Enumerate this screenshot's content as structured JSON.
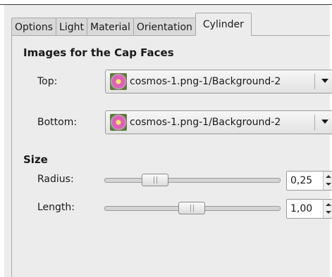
{
  "tabs": [
    {
      "label": "Options",
      "active": false
    },
    {
      "label": "Light",
      "active": false
    },
    {
      "label": "Material",
      "active": false
    },
    {
      "label": "Orientation",
      "active": false
    },
    {
      "label": "Cylinder",
      "active": true
    }
  ],
  "cap_faces": {
    "title": "Images for the Cap Faces",
    "top": {
      "label": "Top:",
      "value": "cosmos-1.png-1/Background-2"
    },
    "bottom": {
      "label": "Bottom:",
      "value": "cosmos-1.png-1/Background-2"
    }
  },
  "size": {
    "title": "Size",
    "radius": {
      "label": "Radius:",
      "value": "0,25",
      "fraction": 0.25
    },
    "length": {
      "label": "Length:",
      "value": "1,00",
      "fraction": 0.5
    }
  }
}
